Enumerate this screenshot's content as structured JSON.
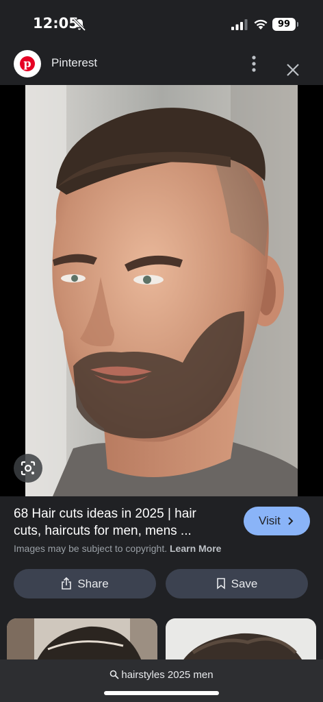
{
  "status_bar": {
    "time": "12:05",
    "battery": "99"
  },
  "source": {
    "name": "Pinterest",
    "logo_letter": "p",
    "brand_color": "#e60023"
  },
  "result": {
    "title_line1": "68 Hair cuts ideas in 2025 | hair",
    "title_line2": "cuts, haircuts for men, mens ...",
    "visit_label": "Visit",
    "copyright_text": "Images may be subject to copyright.",
    "learn_more": "Learn More"
  },
  "actions": {
    "share_label": "Share",
    "save_label": "Save"
  },
  "search": {
    "query": "hairstyles 2025 men"
  },
  "colors": {
    "background": "#202124",
    "accent": "#8ab4f8",
    "button_bg": "#3c4250"
  },
  "icons": [
    "bell-slash-icon",
    "signal-icon",
    "wifi-icon",
    "more-vert-icon",
    "close-icon",
    "lens-icon",
    "share-icon",
    "bookmark-icon",
    "search-icon",
    "chevron-right-icon"
  ]
}
